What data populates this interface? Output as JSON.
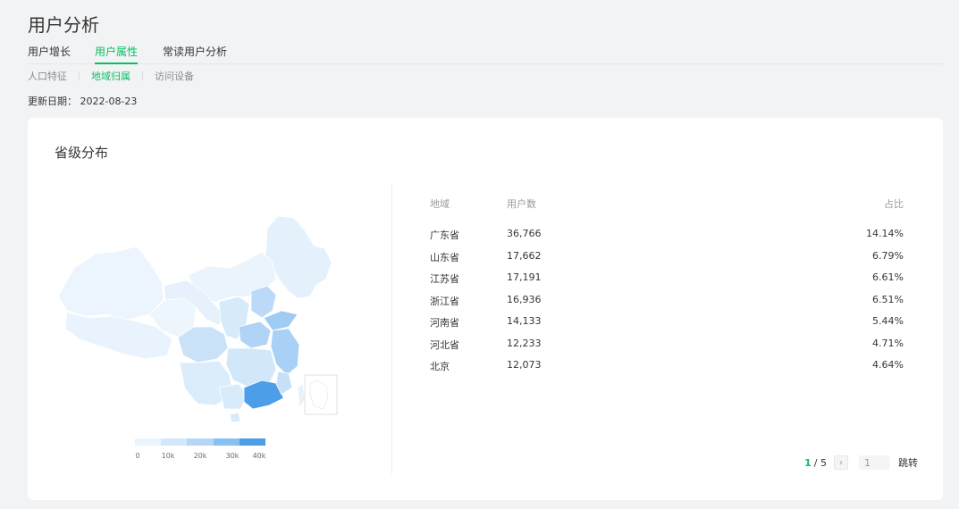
{
  "page": {
    "title": "用户分析"
  },
  "tabs": [
    {
      "label": "用户增长",
      "active": false
    },
    {
      "label": "用户属性",
      "active": true
    },
    {
      "label": "常读用户分析",
      "active": false
    }
  ],
  "subtabs": [
    {
      "label": "人口特征",
      "active": false
    },
    {
      "label": "地域归属",
      "active": true
    },
    {
      "label": "访问设备",
      "active": false
    }
  ],
  "update_date": "更新日期： 2022-08-23",
  "card": {
    "title": "省级分布"
  },
  "legend": {
    "ticks": [
      "0",
      "10k",
      "20k",
      "30k",
      "40k"
    ],
    "colors": [
      "#eaf4fd",
      "#d3e8fb",
      "#b4d7f7",
      "#88c0f2",
      "#4c9ee9"
    ]
  },
  "table": {
    "headers": {
      "region": "地域",
      "users": "用户数",
      "ratio": "占比"
    },
    "rows": [
      {
        "region": "广东省",
        "users": "36,766",
        "ratio": "14.14%"
      },
      {
        "region": "山东省",
        "users": "17,662",
        "ratio": "6.79%"
      },
      {
        "region": "江苏省",
        "users": "17,191",
        "ratio": "6.61%"
      },
      {
        "region": "浙江省",
        "users": "16,936",
        "ratio": "6.51%"
      },
      {
        "region": "河南省",
        "users": "14,133",
        "ratio": "5.44%"
      },
      {
        "region": "河北省",
        "users": "12,233",
        "ratio": "4.71%"
      },
      {
        "region": "北京",
        "users": "12,073",
        "ratio": "4.64%"
      }
    ]
  },
  "pager": {
    "current": "1",
    "total": "/ 5",
    "next_icon": "chevron-right-icon",
    "input_value": "1",
    "jump_label": "跳转"
  },
  "colors": {
    "accent": "#07c160",
    "map_high": "#4c9ee9",
    "map_low": "#eaf4fd"
  }
}
